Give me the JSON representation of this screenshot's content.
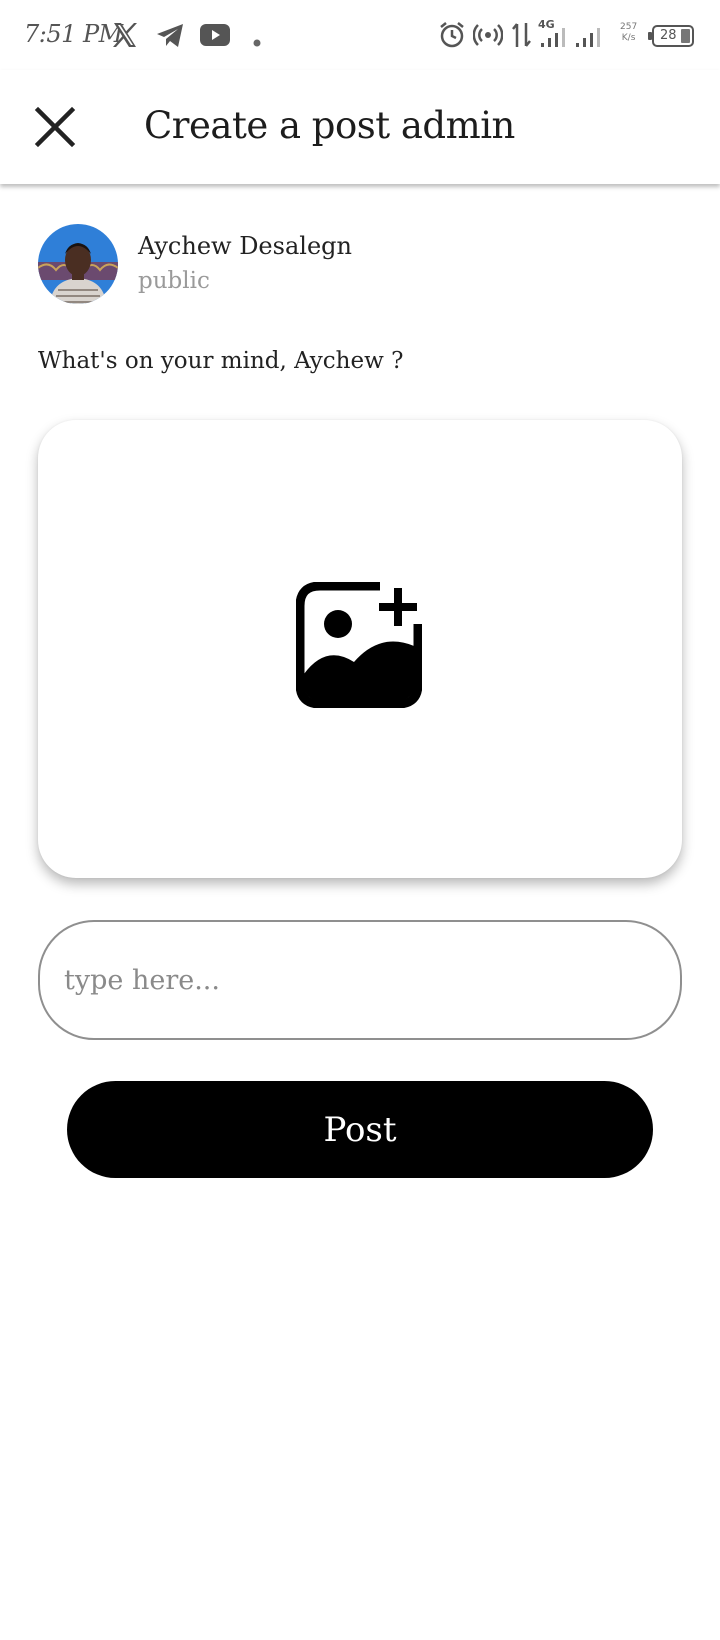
{
  "status_bar": {
    "time": "7:51 PM",
    "network": "4G",
    "speed_top": "257",
    "speed_bottom": "K/s",
    "battery": "28",
    "icons": [
      "x-logo-icon",
      "telegram-icon",
      "youtube-icon",
      "dot-icon",
      "alarm-icon",
      "hotspot-icon",
      "data-arrows-icon",
      "signal-icon",
      "signal-icon",
      "battery-icon"
    ]
  },
  "header": {
    "title": "Create a post admin",
    "close_icon": "close-icon"
  },
  "user": {
    "name": "Aychew Desalegn",
    "privacy": "public"
  },
  "prompt": "What's on your mind, Aychew ?",
  "image_picker": {
    "icon": "add-photo-icon"
  },
  "post_input": {
    "placeholder": "type here...",
    "value": ""
  },
  "post_button": {
    "label": "Post"
  },
  "colors": {
    "button_bg": "#000000",
    "button_text": "#ffffff",
    "input_border": "#8f8f8f",
    "secondary_text": "#9a9a9a"
  }
}
